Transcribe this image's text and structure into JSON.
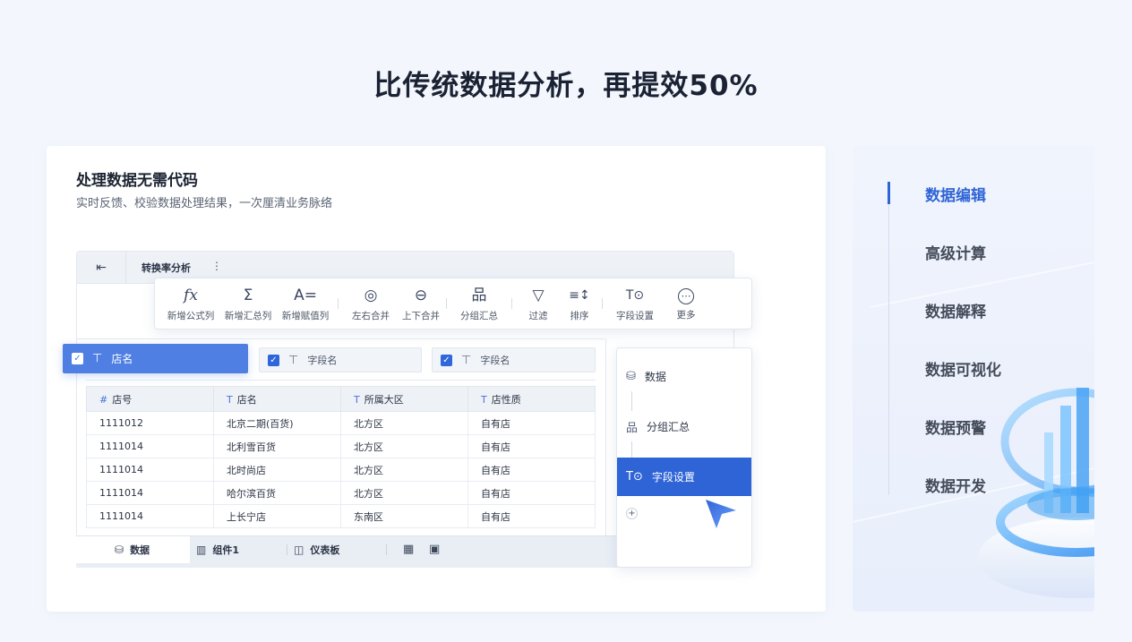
{
  "headline": "比传统数据分析，再提效50%",
  "card": {
    "title": "处理数据无需代码",
    "subtitle": "实时反馈、校验数据处理结果，一次厘清业务脉络"
  },
  "app": {
    "doc_tab": "转换率分析",
    "toolbar": [
      {
        "icon": "fx-icon",
        "glyph": "fx",
        "label": "新增公式列"
      },
      {
        "icon": "sigma-icon",
        "glyph": "Σ",
        "label": "新增汇总列"
      },
      {
        "icon": "assign-icon",
        "glyph": "A=",
        "label": "新增赋值列"
      },
      {
        "icon": "merge-horizontal-icon",
        "glyph": "◎",
        "label": "左右合并"
      },
      {
        "icon": "merge-vertical-icon",
        "glyph": "⊖",
        "label": "上下合并"
      },
      {
        "icon": "group-icon",
        "glyph": "品",
        "label": "分组汇总"
      },
      {
        "icon": "filter-icon",
        "glyph": "▽",
        "label": "过滤"
      },
      {
        "icon": "sort-icon",
        "glyph": "≡↕",
        "label": "排序"
      },
      {
        "icon": "field-settings-icon",
        "glyph": "T⊙",
        "label": "字段设置"
      },
      {
        "icon": "more-icon",
        "glyph": "⋯",
        "label": "更多"
      }
    ],
    "fields": [
      {
        "label": "店名",
        "checked": true
      },
      {
        "label": "字段名",
        "checked": true
      },
      {
        "label": "字段名",
        "checked": true
      }
    ],
    "table": {
      "columns": [
        {
          "icon": "#",
          "label": "店号"
        },
        {
          "icon": "T",
          "label": "店名"
        },
        {
          "icon": "T",
          "label": "所属大区"
        },
        {
          "icon": "T",
          "label": "店性质"
        }
      ],
      "rows": [
        [
          "1111012",
          "北京二期(百货)",
          "北方区",
          "自有店"
        ],
        [
          "1111014",
          "北利雪百货",
          "北方区",
          "自有店"
        ],
        [
          "1111014",
          "北时尚店",
          "北方区",
          "自有店"
        ],
        [
          "1111014",
          "哈尔滨百货",
          "北方区",
          "自有店"
        ],
        [
          "1111014",
          "上长宁店",
          "东南区",
          "自有店"
        ]
      ]
    },
    "bottom_tabs": [
      {
        "label": "数据"
      },
      {
        "label": "组件1"
      },
      {
        "label": "仪表板"
      }
    ],
    "steps": [
      {
        "label": "数据"
      },
      {
        "label": "分组汇总"
      },
      {
        "label": "字段设置"
      }
    ]
  },
  "nav": {
    "items": [
      "数据编辑",
      "高级计算",
      "数据解释",
      "数据可视化",
      "数据预警",
      "数据开发"
    ],
    "active": 0
  },
  "colors": {
    "accent": "#2f64d6",
    "selected_field": "#4f7fe3",
    "background": "#f3f7fd"
  }
}
